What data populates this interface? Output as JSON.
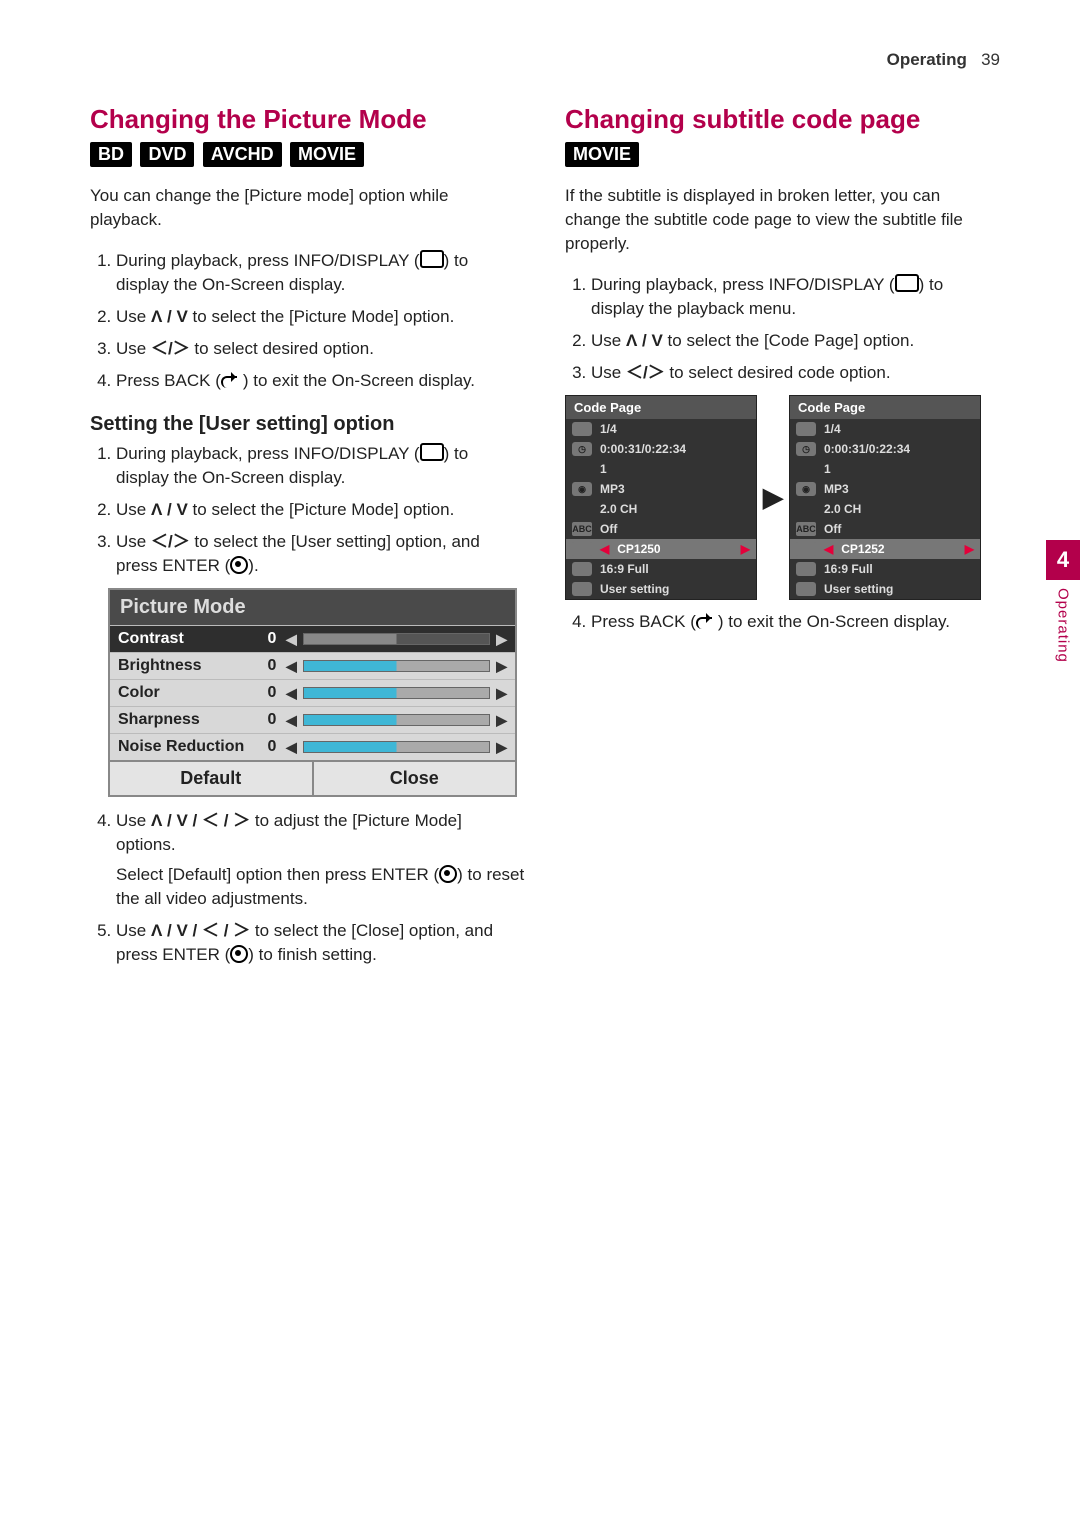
{
  "header": {
    "section": "Operating",
    "page": "39"
  },
  "side_tab": {
    "num": "4",
    "label": "Operating"
  },
  "left": {
    "heading1": "Changing the Picture Mode",
    "tags1": [
      "BD",
      "DVD",
      "AVCHD",
      "MOVIE"
    ],
    "intro1": "You can change the [Picture mode] option while playback.",
    "steps1": [
      {
        "pre": "During playback, press INFO/DISPLAY (",
        "post": ") to display the On-Screen display."
      },
      {
        "pre": "Use ",
        "sym": "Ʌ / V",
        "post": " to select the [Picture Mode] option."
      },
      {
        "pre": "Use ",
        "sym": "＜/＞",
        "post": " to select desired option."
      },
      {
        "pre": "Press BACK (",
        "post": ") to exit the On-Screen display."
      }
    ],
    "heading2": "Setting the [User setting] option",
    "steps2": [
      {
        "pre": "During playback, press INFO/DISPLAY (",
        "post": ") to display the On-Screen display."
      },
      {
        "pre": "Use ",
        "sym": "Ʌ / V",
        "post": " to select the [Picture Mode] option."
      },
      {
        "pre": "Use ",
        "sym": "＜/＞",
        "post": " to select the [User setting] option, and press ENTER (",
        "post2": ")."
      }
    ],
    "picture_mode": {
      "title": "Picture Mode",
      "rows": [
        {
          "label": "Contrast",
          "val": "0",
          "active": true
        },
        {
          "label": "Brightness",
          "val": "0"
        },
        {
          "label": "Color",
          "val": "0"
        },
        {
          "label": "Sharpness",
          "val": "0"
        },
        {
          "label": "Noise Reduction",
          "val": "0"
        }
      ],
      "footer": {
        "left": "Default",
        "right": "Close"
      }
    },
    "steps3": [
      {
        "pre": "Use ",
        "sym": "Ʌ / V / ＜ / ＞",
        "post": " to adjust the [Picture Mode] options.",
        "extra": "Select [Default] option then press ENTER (",
        "extra_post": ") to reset the all video adjustments."
      },
      {
        "pre": "Use ",
        "sym": "Ʌ / V / ＜ / ＞",
        "post": " to select the [Close] option, and press ENTER (",
        "post2": ") to finish setting."
      }
    ]
  },
  "right": {
    "heading": "Changing subtitle code page",
    "tags": [
      "MOVIE"
    ],
    "intro": "If the subtitle is displayed in broken letter, you can change the subtitle code page to view the subtitle file properly.",
    "steps": [
      {
        "pre": "During playback, press INFO/DISPLAY (",
        "post": ") to display the playback menu."
      },
      {
        "pre": "Use ",
        "sym": "Ʌ / V",
        "post": " to select the [Code Page] option."
      },
      {
        "pre": "Use ",
        "sym": "＜/＞",
        "post": " to select desired code option."
      }
    ],
    "code_page": {
      "title": "Code Page",
      "rows": [
        {
          "val": "1/4"
        },
        {
          "val": "0:00:31/0:22:34"
        },
        {
          "val": "1"
        },
        {
          "val": "MP3"
        },
        {
          "val": "2.0 CH"
        },
        {
          "val": "Off",
          "icon": "ABC"
        },
        {
          "val_left": "CP1250",
          "val_right": "CP1252",
          "selected": true
        },
        {
          "val": "16:9 Full"
        },
        {
          "val": "User setting"
        }
      ]
    },
    "step4": {
      "pre": "Press BACK (",
      "post": ") to exit the On-Screen display."
    }
  }
}
